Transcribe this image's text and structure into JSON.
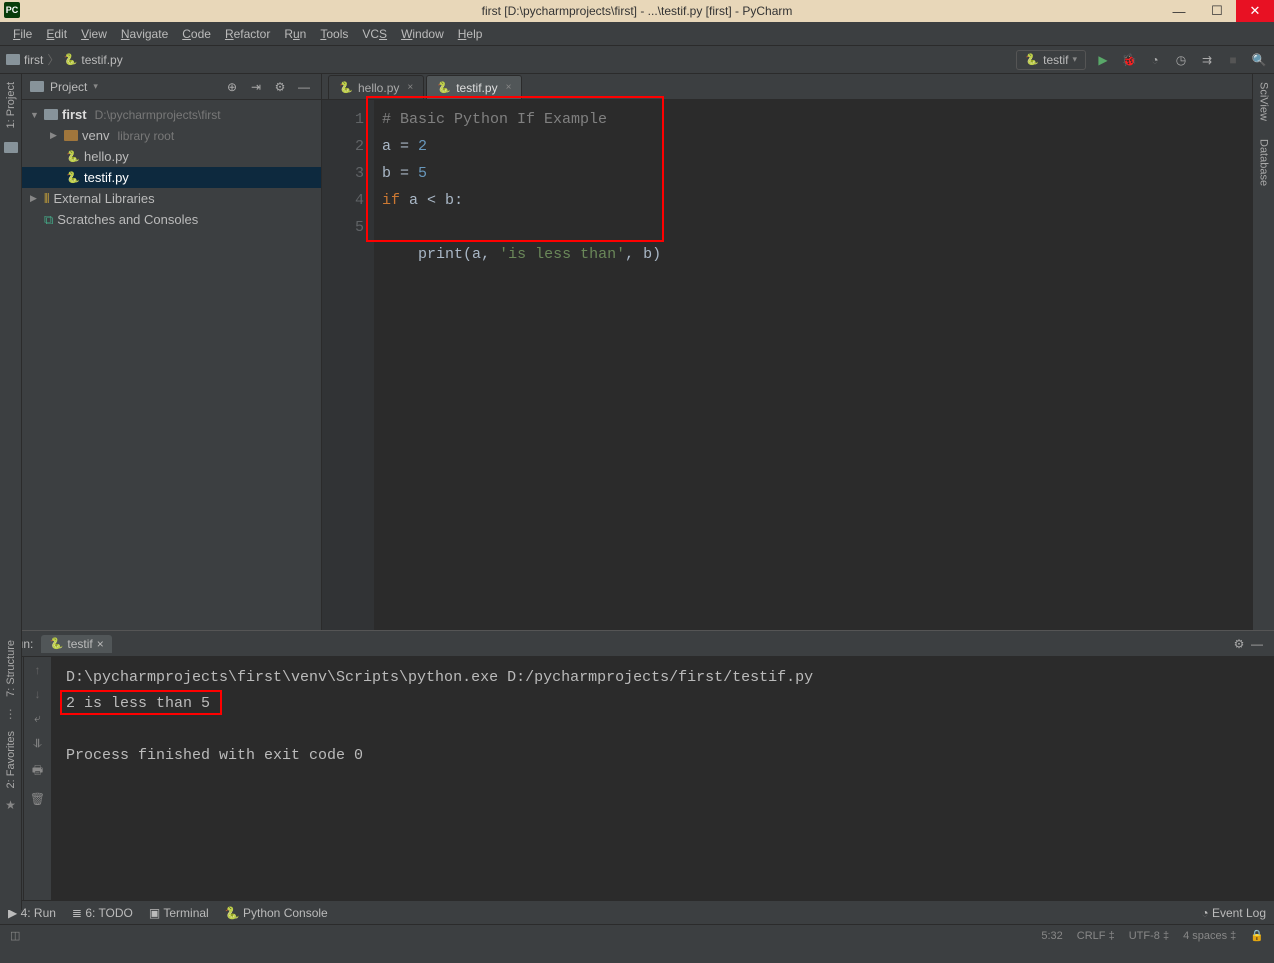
{
  "title": "first [D:\\pycharmprojects\\first] - ...\\testif.py [first] - PyCharm",
  "appIconText": "PC",
  "menu": [
    "File",
    "Edit",
    "View",
    "Navigate",
    "Code",
    "Refactor",
    "Run",
    "Tools",
    "VCS",
    "Window",
    "Help"
  ],
  "breadcrumb": {
    "folder": "first",
    "file": "testif.py"
  },
  "runConfig": "testif",
  "projectPanel": {
    "title": "Project",
    "tree": {
      "root": "first",
      "rootPath": "D:\\pycharmprojects\\first",
      "venv": "venv",
      "venvHint": "library root",
      "files": [
        "hello.py",
        "testif.py"
      ],
      "external": "External Libraries",
      "scratches": "Scratches and Consoles"
    }
  },
  "editor": {
    "tabs": [
      {
        "name": "hello.py",
        "active": false
      },
      {
        "name": "testif.py",
        "active": true
      }
    ],
    "lineNumbers": [
      "1",
      "2",
      "3",
      "4",
      "",
      "5"
    ],
    "code": {
      "l1_comment": "# Basic Python If Example",
      "l2_a": "a",
      "l2_eq": " = ",
      "l2_val": "2",
      "l3_b": "b",
      "l3_eq": " = ",
      "l3_val": "5",
      "l4_if": "if ",
      "l4_a": "a",
      "l4_op": " < ",
      "l4_b": "b",
      "l4_colon": ":",
      "l5_indent": "    ",
      "l5_print": "print",
      "l5_open": "(",
      "l5_a": "a",
      "l5_c1": ", ",
      "l5_str": "'is less than'",
      "l5_c2": ", ",
      "l5_b": "b",
      "l5_close": ")"
    }
  },
  "runPanel": {
    "label": "Run:",
    "tab": "testif",
    "cmd": "D:\\pycharmprojects\\first\\venv\\Scripts\\python.exe D:/pycharmprojects/first/testif.py",
    "output": "2 is less than 5",
    "exit": "Process finished with exit code 0"
  },
  "sideTools": {
    "project": "1: Project",
    "structure": "7: Structure",
    "favorites": "2: Favorites",
    "sciview": "SciView",
    "database": "Database"
  },
  "bottom": {
    "run": "4: Run",
    "todo": "6: TODO",
    "terminal": "Terminal",
    "pyconsole": "Python Console",
    "eventlog": "Event Log"
  },
  "status": {
    "pos": "5:32",
    "sep": "CRLF",
    "enc": "UTF-8",
    "indent": "4 spaces"
  }
}
